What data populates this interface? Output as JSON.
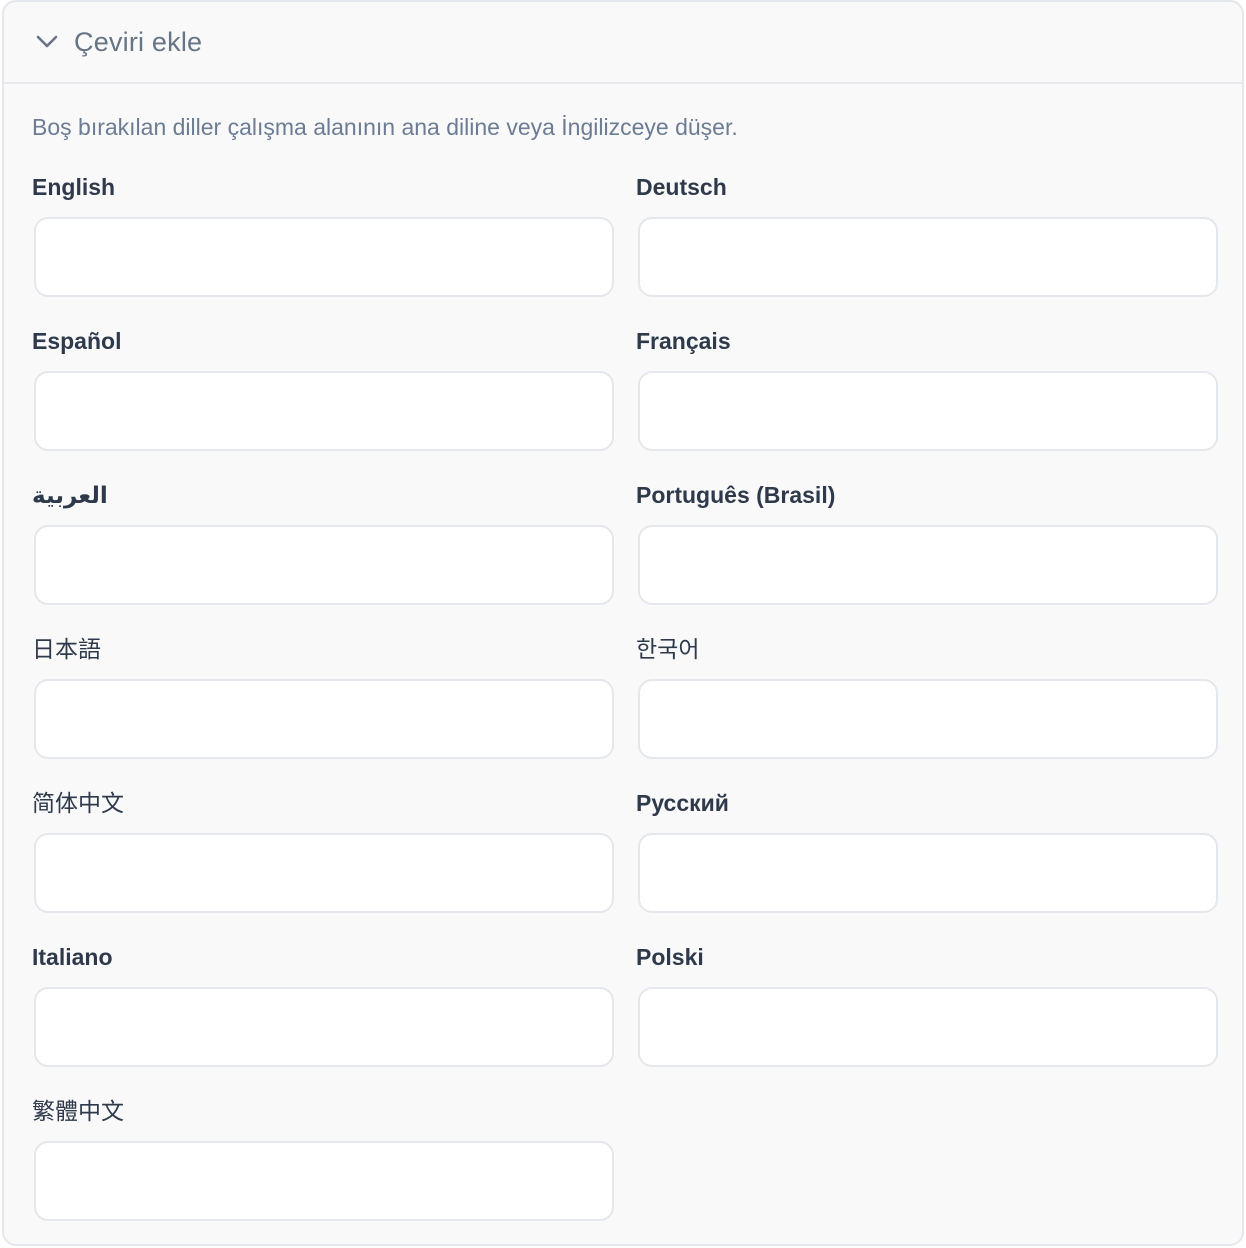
{
  "section": {
    "title": "Çeviri ekle",
    "expanded": true,
    "hint": "Boş bırakılan diller çalışma alanının ana diline veya İngilizceye düşer."
  },
  "fields": [
    {
      "label": "English",
      "value": ""
    },
    {
      "label": "Deutsch",
      "value": ""
    },
    {
      "label": "Español",
      "value": ""
    },
    {
      "label": "Français",
      "value": ""
    },
    {
      "label": "العربية",
      "value": ""
    },
    {
      "label": "Português (Brasil)",
      "value": ""
    },
    {
      "label": "日本語",
      "value": ""
    },
    {
      "label": "한국어",
      "value": ""
    },
    {
      "label": "简体中文",
      "value": ""
    },
    {
      "label": "Русский",
      "value": ""
    },
    {
      "label": "Italiano",
      "value": ""
    },
    {
      "label": "Polski",
      "value": ""
    },
    {
      "label": "繁體中文",
      "value": ""
    }
  ],
  "icons": {
    "toggle": "chevron-down-icon"
  },
  "colors": {
    "panel_background": "#f9f9f9",
    "border": "#e4e7eb",
    "label_text": "#2e3a4b",
    "muted_text": "#667485"
  }
}
